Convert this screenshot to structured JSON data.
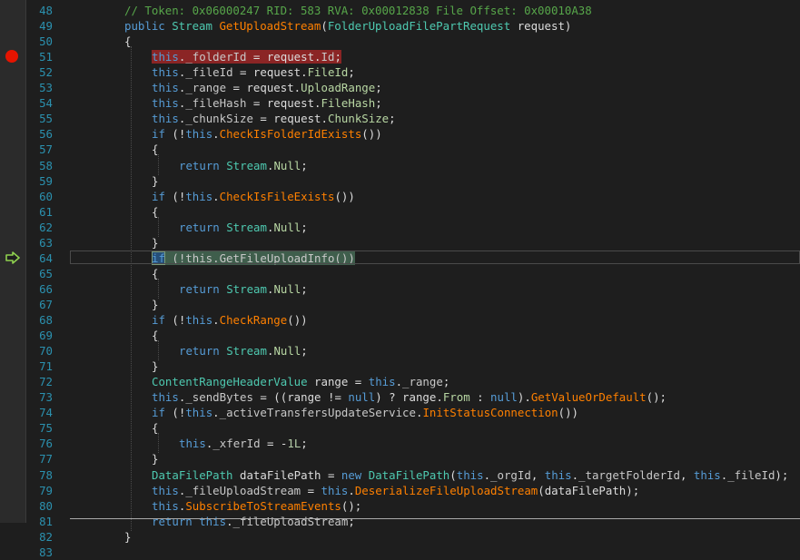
{
  "editor": {
    "breakpoint_line": 51,
    "current_line": 64,
    "lines": [
      {
        "n": "48",
        "i": 0,
        "s": [
          [
            "c",
            "// Token: 0x06000247 RID: 583 RVA: 0x00012838 File Offset: 0x00010A38"
          ]
        ]
      },
      {
        "n": "49",
        "i": 0,
        "s": [
          [
            "k",
            "public "
          ],
          [
            "t",
            "Stream "
          ],
          [
            "m",
            "GetUploadStream"
          ],
          [
            "",
            "("
          ],
          [
            "t",
            "FolderUploadFilePartRequest "
          ],
          [
            "",
            "request)"
          ]
        ]
      },
      {
        "n": "50",
        "i": 0,
        "s": [
          [
            "",
            "{"
          ]
        ]
      },
      {
        "n": "51",
        "i": 1,
        "s": [
          [
            "k",
            "this"
          ],
          [
            "",
            ".",
            ""
          ],
          [
            "p",
            "_folderId"
          ],
          [
            "",
            " = request."
          ],
          [
            "p",
            "Id"
          ],
          [
            "",
            ";"
          ]
        ],
        "hl": "bp"
      },
      {
        "n": "52",
        "i": 1,
        "s": [
          [
            "k",
            "this"
          ],
          [
            "",
            "."
          ],
          [
            "p",
            "_fileId"
          ],
          [
            "",
            " = request."
          ],
          [
            "t2",
            "FileId"
          ],
          [
            "",
            ";"
          ]
        ]
      },
      {
        "n": "53",
        "i": 1,
        "s": [
          [
            "k",
            "this"
          ],
          [
            "",
            "."
          ],
          [
            "p",
            "_range"
          ],
          [
            "",
            " = request."
          ],
          [
            "t2",
            "UploadRange"
          ],
          [
            "",
            ";"
          ]
        ]
      },
      {
        "n": "54",
        "i": 1,
        "s": [
          [
            "k",
            "this"
          ],
          [
            "",
            "."
          ],
          [
            "p",
            "_fileHash"
          ],
          [
            "",
            " = request."
          ],
          [
            "t2",
            "FileHash"
          ],
          [
            "",
            ";"
          ]
        ]
      },
      {
        "n": "55",
        "i": 1,
        "s": [
          [
            "k",
            "this"
          ],
          [
            "",
            "."
          ],
          [
            "p",
            "_chunkSize"
          ],
          [
            "",
            " = request."
          ],
          [
            "t2",
            "ChunkSize"
          ],
          [
            "",
            ";"
          ]
        ]
      },
      {
        "n": "56",
        "i": 1,
        "s": [
          [
            "k",
            "if "
          ],
          [
            "",
            "(!"
          ],
          [
            "k",
            "this"
          ],
          [
            "",
            "."
          ],
          [
            "m",
            "CheckIsFolderIdExists"
          ],
          [
            "",
            "())"
          ]
        ]
      },
      {
        "n": "57",
        "i": 1,
        "s": [
          [
            "",
            "{"
          ]
        ]
      },
      {
        "n": "58",
        "i": 2,
        "s": [
          [
            "k",
            "return "
          ],
          [
            "t",
            "Stream"
          ],
          [
            "",
            "."
          ],
          [
            "t2",
            "Null"
          ],
          [
            "",
            ";"
          ]
        ]
      },
      {
        "n": "59",
        "i": 1,
        "s": [
          [
            "",
            "}"
          ]
        ]
      },
      {
        "n": "60",
        "i": 1,
        "s": [
          [
            "k",
            "if "
          ],
          [
            "",
            "(!"
          ],
          [
            "k",
            "this"
          ],
          [
            "",
            "."
          ],
          [
            "m",
            "CheckIsFileExists"
          ],
          [
            "",
            "())"
          ]
        ]
      },
      {
        "n": "61",
        "i": 1,
        "s": [
          [
            "",
            "{"
          ]
        ]
      },
      {
        "n": "62",
        "i": 2,
        "s": [
          [
            "k",
            "return "
          ],
          [
            "t",
            "Stream"
          ],
          [
            "",
            "."
          ],
          [
            "t2",
            "Null"
          ],
          [
            "",
            ";"
          ]
        ]
      },
      {
        "n": "63",
        "i": 1,
        "s": [
          [
            "",
            "}"
          ]
        ]
      },
      {
        "n": "64",
        "i": 1,
        "s": [
          [
            "k",
            "if"
          ],
          [
            "",
            " (!this.GetFileUploadInfo())"
          ]
        ],
        "hl": "cur"
      },
      {
        "n": "65",
        "i": 1,
        "s": [
          [
            "",
            "{"
          ]
        ]
      },
      {
        "n": "66",
        "i": 2,
        "s": [
          [
            "k",
            "return "
          ],
          [
            "t",
            "Stream"
          ],
          [
            "",
            "."
          ],
          [
            "t2",
            "Null"
          ],
          [
            "",
            ";"
          ]
        ]
      },
      {
        "n": "67",
        "i": 1,
        "s": [
          [
            "",
            "}"
          ]
        ]
      },
      {
        "n": "68",
        "i": 1,
        "s": [
          [
            "k",
            "if "
          ],
          [
            "",
            "(!"
          ],
          [
            "k",
            "this"
          ],
          [
            "",
            "."
          ],
          [
            "m",
            "CheckRange"
          ],
          [
            "",
            "())"
          ]
        ]
      },
      {
        "n": "69",
        "i": 1,
        "s": [
          [
            "",
            "{"
          ]
        ]
      },
      {
        "n": "70",
        "i": 2,
        "s": [
          [
            "k",
            "return "
          ],
          [
            "t",
            "Stream"
          ],
          [
            "",
            "."
          ],
          [
            "t2",
            "Null"
          ],
          [
            "",
            ";"
          ]
        ]
      },
      {
        "n": "71",
        "i": 1,
        "s": [
          [
            "",
            "}"
          ]
        ]
      },
      {
        "n": "72",
        "i": 1,
        "s": [
          [
            "t",
            "ContentRangeHeaderValue "
          ],
          [
            "",
            "range = "
          ],
          [
            "k",
            "this"
          ],
          [
            "",
            "."
          ],
          [
            "p",
            "_range"
          ],
          [
            "",
            ";"
          ]
        ]
      },
      {
        "n": "73",
        "i": 1,
        "s": [
          [
            "k",
            "this"
          ],
          [
            "",
            "."
          ],
          [
            "p",
            "_sendBytes"
          ],
          [
            "",
            " = ((range != "
          ],
          [
            "k",
            "null"
          ],
          [
            "",
            ") ? range."
          ],
          [
            "t2",
            "From"
          ],
          [
            "",
            " : "
          ],
          [
            "k",
            "null"
          ],
          [
            "",
            ")."
          ],
          [
            "m",
            "GetValueOrDefault"
          ],
          [
            "",
            "();"
          ]
        ]
      },
      {
        "n": "74",
        "i": 1,
        "s": [
          [
            "k",
            "if "
          ],
          [
            "",
            "(!"
          ],
          [
            "k",
            "this"
          ],
          [
            "",
            "."
          ],
          [
            "p",
            "_activeTransfersUpdateService"
          ],
          [
            "",
            "."
          ],
          [
            "m",
            "InitStatusConnection"
          ],
          [
            "",
            "())"
          ]
        ]
      },
      {
        "n": "75",
        "i": 1,
        "s": [
          [
            "",
            "{"
          ]
        ]
      },
      {
        "n": "76",
        "i": 2,
        "s": [
          [
            "k",
            "this"
          ],
          [
            "",
            "."
          ],
          [
            "p",
            "_xferId"
          ],
          [
            "",
            " = -"
          ],
          [
            "lit",
            "1L"
          ],
          [
            "",
            ";"
          ]
        ]
      },
      {
        "n": "77",
        "i": 1,
        "s": [
          [
            "",
            "}"
          ]
        ]
      },
      {
        "n": "78",
        "i": 1,
        "s": [
          [
            "t",
            "DataFilePath "
          ],
          [
            "",
            "dataFilePath = "
          ],
          [
            "k",
            "new "
          ],
          [
            "t",
            "DataFilePath"
          ],
          [
            "",
            "("
          ],
          [
            "k",
            "this"
          ],
          [
            "",
            "."
          ],
          [
            "p",
            "_orgId"
          ],
          [
            "",
            ", "
          ],
          [
            "k",
            "this"
          ],
          [
            "",
            "."
          ],
          [
            "p",
            "_targetFolderId"
          ],
          [
            "",
            ", "
          ],
          [
            "k",
            "this"
          ],
          [
            "",
            "."
          ],
          [
            "p",
            "_fileId"
          ],
          [
            "",
            ");"
          ]
        ]
      },
      {
        "n": "79",
        "i": 1,
        "s": [
          [
            "k",
            "this"
          ],
          [
            "",
            "."
          ],
          [
            "p",
            "_fileUploadStream"
          ],
          [
            "",
            " = "
          ],
          [
            "k",
            "this"
          ],
          [
            "",
            "."
          ],
          [
            "m",
            "DeserializeFileUploadStream"
          ],
          [
            "",
            "(dataFilePath);"
          ]
        ]
      },
      {
        "n": "80",
        "i": 1,
        "s": [
          [
            "k",
            "this"
          ],
          [
            "",
            "."
          ],
          [
            "m",
            "SubscribeToStreamEvents"
          ],
          [
            "",
            "();"
          ]
        ]
      },
      {
        "n": "81",
        "i": 1,
        "s": [
          [
            "k",
            "return this"
          ],
          [
            "",
            "."
          ],
          [
            "p",
            "_fileUploadStream"
          ],
          [
            "",
            ";"
          ]
        ]
      },
      {
        "n": "82",
        "i": 0,
        "s": [
          [
            "",
            "}"
          ]
        ]
      },
      {
        "n": "83",
        "i": 0,
        "s": []
      }
    ]
  }
}
